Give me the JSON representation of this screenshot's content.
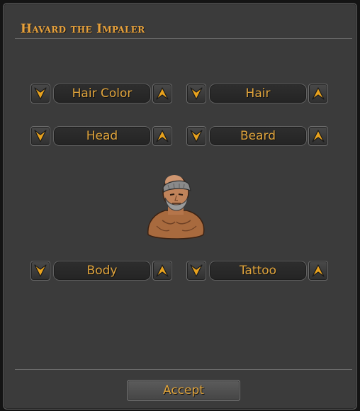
{
  "window": {
    "title": "Havard the Impaler"
  },
  "options": {
    "hair_color": {
      "label": "Hair Color"
    },
    "hair": {
      "label": "Hair"
    },
    "head": {
      "label": "Head"
    },
    "beard": {
      "label": "Beard"
    },
    "body": {
      "label": "Body"
    },
    "tattoo": {
      "label": "Tattoo"
    }
  },
  "icons": {
    "prev": "arrow-down-icon",
    "next": "arrow-up-icon"
  },
  "colors": {
    "accent": "#e0a43c",
    "panel": "#3b3b3b",
    "arrow": "#e8a21e"
  },
  "accept_label": "Accept"
}
